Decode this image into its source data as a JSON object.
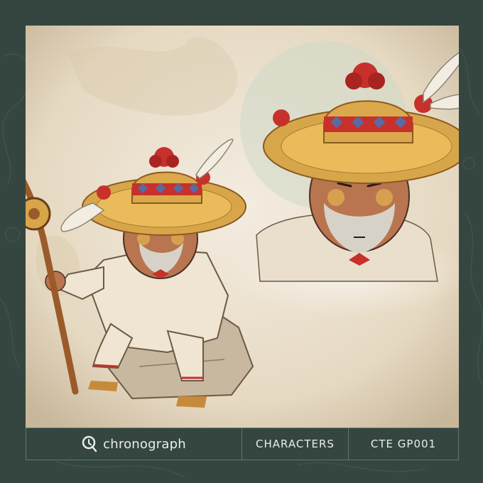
{
  "brand": {
    "name": "chronograph",
    "icon": "chronograph-logo-icon"
  },
  "category": "CHARACTERS",
  "code": "CTE GP001",
  "colors": {
    "frame": "#34463f",
    "parchment": "#ece2cf",
    "hat_red": "#c8302c",
    "hat_straw": "#d8a64a",
    "text": "#e9eeec",
    "rule": "#5c7870"
  }
}
